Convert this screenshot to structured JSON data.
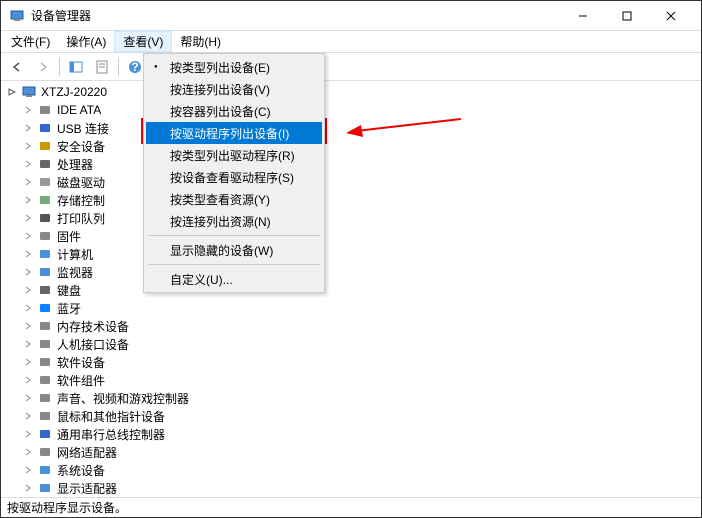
{
  "window": {
    "title": "设备管理器"
  },
  "menubar": {
    "file": "文件(F)",
    "action": "操作(A)",
    "view": "查看(V)",
    "help": "帮助(H)"
  },
  "dropdown": {
    "byType": "按类型列出设备(E)",
    "byConnection": "按连接列出设备(V)",
    "byContainer": "按容器列出设备(C)",
    "byDriver": "按驱动程序列出设备(I)",
    "driversByType": "按类型列出驱动程序(R)",
    "driversByDevice": "按设备查看驱动程序(S)",
    "resourcesByType": "按类型查看资源(Y)",
    "resourcesByConnection": "按连接列出资源(N)",
    "showHidden": "显示隐藏的设备(W)",
    "customize": "自定义(U)..."
  },
  "tree": {
    "root": "XTZJ-20220",
    "items": [
      "IDE ATA",
      "USB 连接",
      "安全设备",
      "处理器",
      "磁盘驱动",
      "存储控制",
      "打印队列",
      "固件",
      "计算机",
      "监视器",
      "键盘",
      "蓝牙",
      "内存技术设备",
      "人机接口设备",
      "软件设备",
      "软件组件",
      "声音、视频和游戏控制器",
      "鼠标和其他指针设备",
      "通用串行总线控制器",
      "网络适配器",
      "系统设备",
      "显示适配器"
    ]
  },
  "statusbar": {
    "text": "按驱动程序显示设备。"
  },
  "icons": {
    "device": "🖥",
    "ide": "⛃",
    "usb": "ψ",
    "security": "🔒",
    "cpu": "▢",
    "disk": "⛁",
    "storage": "◇",
    "printer": "🖨",
    "firmware": "▤",
    "computer": "🖥",
    "monitor": "🖵",
    "keyboard": "⌨",
    "bluetooth": "ᚼ",
    "memory": "▯",
    "hid": "🖰",
    "software": "⚙",
    "component": "▦",
    "audio": "🔊",
    "mouse": "🖱",
    "usbctrl": "ψ",
    "network": "🖧",
    "system": "🖥",
    "display": "🖵"
  }
}
